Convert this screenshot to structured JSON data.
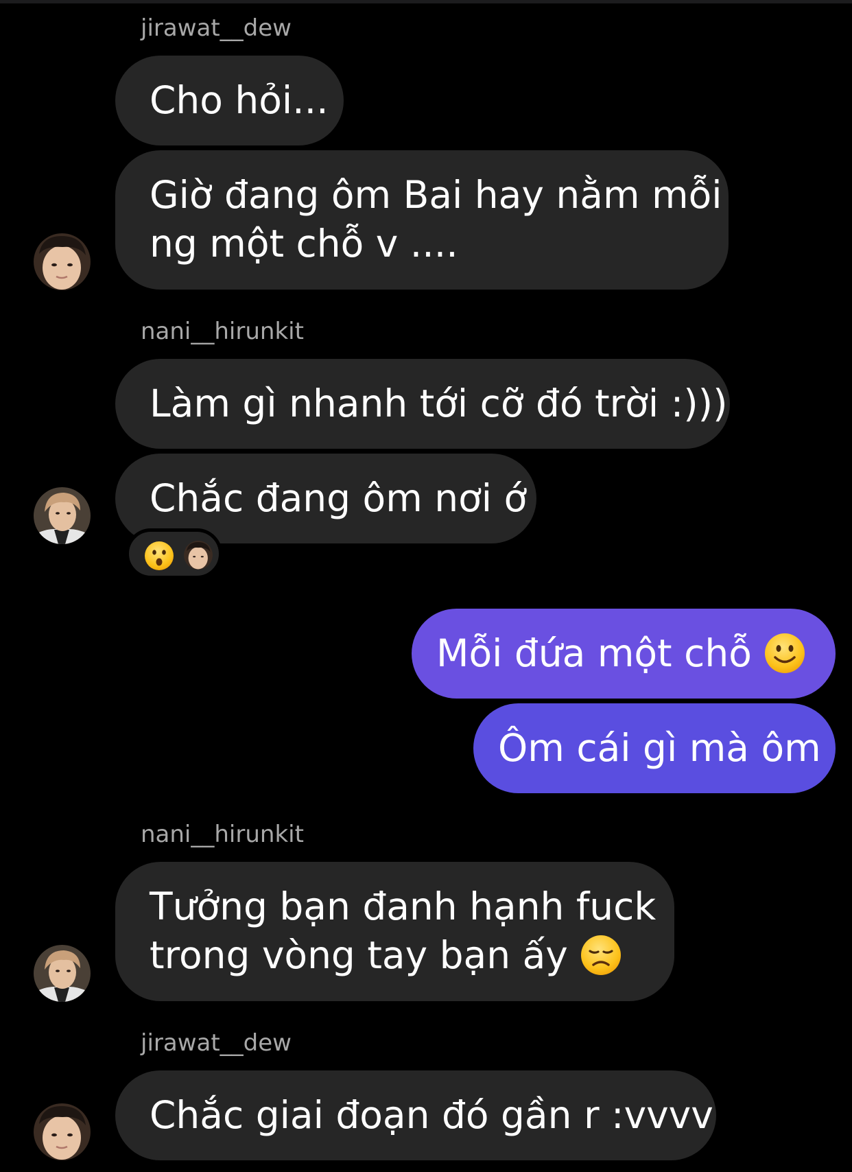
{
  "colors": {
    "background": "#000000",
    "incoming_bubble": "#262626",
    "outgoing_gradient_top": "#6b4fe0",
    "outgoing_gradient_bottom": "#5b4de0",
    "sender_name": "#a8a8a8",
    "text": "#ffffff"
  },
  "thread": {
    "groups": [
      {
        "sender": "jirawat__dew",
        "avatar_icon": "profile-photo-jirawat",
        "messages": [
          {
            "lines": [
              "Cho hỏi..."
            ]
          },
          {
            "lines": [
              "Giờ đang ôm Bai hay nằm mỗi",
              "ng một chỗ v ...."
            ]
          }
        ]
      },
      {
        "sender": "nani__hirunkit",
        "avatar_icon": "profile-photo-nani",
        "messages": [
          {
            "lines": [
              "Làm gì nhanh tới cỡ đó trời :)))"
            ]
          },
          {
            "lines": [
              "Chắc đang ôm nơi ớ"
            ],
            "reaction": {
              "emoji_icon": "astonished-face-icon",
              "reactor_icon": "profile-photo-jirawat"
            }
          }
        ]
      },
      {
        "sender": "me",
        "messages": [
          {
            "lines": [
              "Mỗi đứa một chỗ"
            ],
            "trailing_emoji_icon": "slightly-smiling-face-icon"
          },
          {
            "lines": [
              "Ôm cái gì mà ôm"
            ]
          }
        ]
      },
      {
        "sender": "nani__hirunkit",
        "avatar_icon": "profile-photo-nani",
        "messages": [
          {
            "lines": [
              "Tưởng bạn đanh hạnh fuck",
              "trong vòng tay bạn ấy"
            ],
            "trailing_emoji_icon": "disappointed-face-icon"
          }
        ]
      },
      {
        "sender": "jirawat__dew",
        "avatar_icon": "profile-photo-jirawat",
        "messages": [
          {
            "lines": [
              "Chắc giai đoạn đó gần r :vvvv"
            ]
          }
        ]
      }
    ]
  }
}
